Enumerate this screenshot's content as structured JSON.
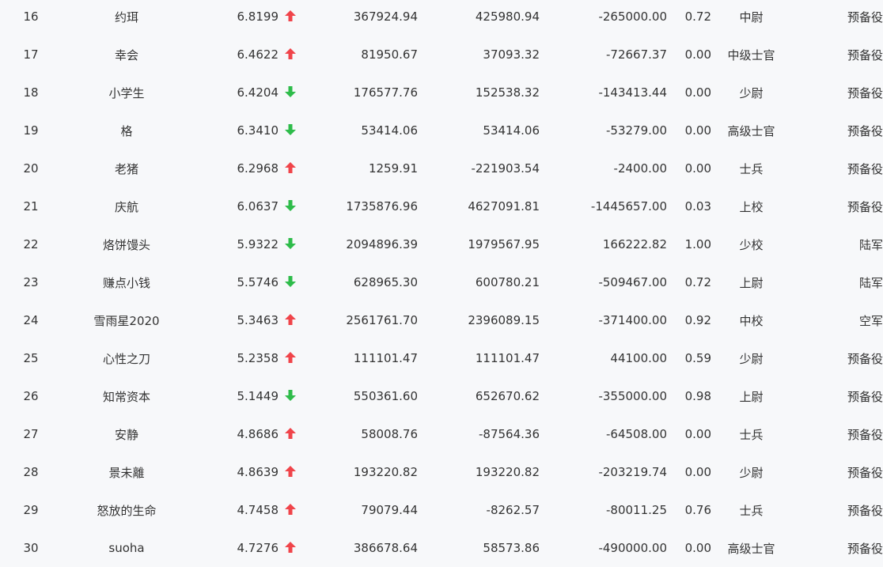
{
  "colors": {
    "up": "#f0444a",
    "down": "#2ebc4a",
    "text": "#333333",
    "background": "#f7f8fa"
  },
  "rows": [
    {
      "rank": "16",
      "name": "约珥",
      "score": "6.8199",
      "trend": "up",
      "trend_icon": "arrow-up-icon",
      "v1": "367924.94",
      "v2": "425980.94",
      "v3": "-265000.00",
      "ratio": "0.72",
      "level": "中尉",
      "branch": "预备役"
    },
    {
      "rank": "17",
      "name": "幸会",
      "score": "6.4622",
      "trend": "up",
      "trend_icon": "arrow-up-icon",
      "v1": "81950.67",
      "v2": "37093.32",
      "v3": "-72667.37",
      "ratio": "0.00",
      "level": "中级士官",
      "branch": "预备役"
    },
    {
      "rank": "18",
      "name": "小学生",
      "score": "6.4204",
      "trend": "down",
      "trend_icon": "arrow-down-icon",
      "v1": "176577.76",
      "v2": "152538.32",
      "v3": "-143413.44",
      "ratio": "0.00",
      "level": "少尉",
      "branch": "预备役"
    },
    {
      "rank": "19",
      "name": "格",
      "score": "6.3410",
      "trend": "down",
      "trend_icon": "arrow-down-icon",
      "v1": "53414.06",
      "v2": "53414.06",
      "v3": "-53279.00",
      "ratio": "0.00",
      "level": "高级士官",
      "branch": "预备役"
    },
    {
      "rank": "20",
      "name": "老猪",
      "score": "6.2968",
      "trend": "up",
      "trend_icon": "arrow-up-icon",
      "v1": "1259.91",
      "v2": "-221903.54",
      "v3": "-2400.00",
      "ratio": "0.00",
      "level": "士兵",
      "branch": "预备役"
    },
    {
      "rank": "21",
      "name": "庆航",
      "score": "6.0637",
      "trend": "down",
      "trend_icon": "arrow-down-icon",
      "v1": "1735876.96",
      "v2": "4627091.81",
      "v3": "-1445657.00",
      "ratio": "0.03",
      "level": "上校",
      "branch": "预备役"
    },
    {
      "rank": "22",
      "name": "烙饼馒头",
      "score": "5.9322",
      "trend": "down",
      "trend_icon": "arrow-down-icon",
      "v1": "2094896.39",
      "v2": "1979567.95",
      "v3": "166222.82",
      "ratio": "1.00",
      "level": "少校",
      "branch": "陆军"
    },
    {
      "rank": "23",
      "name": "赚点小钱",
      "score": "5.5746",
      "trend": "down",
      "trend_icon": "arrow-down-icon",
      "v1": "628965.30",
      "v2": "600780.21",
      "v3": "-509467.00",
      "ratio": "0.72",
      "level": "上尉",
      "branch": "陆军"
    },
    {
      "rank": "24",
      "name": "雪雨星2020",
      "score": "5.3463",
      "trend": "up",
      "trend_icon": "arrow-up-icon",
      "v1": "2561761.70",
      "v2": "2396089.15",
      "v3": "-371400.00",
      "ratio": "0.92",
      "level": "中校",
      "branch": "空军"
    },
    {
      "rank": "25",
      "name": "心性之刀",
      "score": "5.2358",
      "trend": "up",
      "trend_icon": "arrow-up-icon",
      "v1": "111101.47",
      "v2": "111101.47",
      "v3": "44100.00",
      "ratio": "0.59",
      "level": "少尉",
      "branch": "预备役"
    },
    {
      "rank": "26",
      "name": "知常资本",
      "score": "5.1449",
      "trend": "down",
      "trend_icon": "arrow-down-icon",
      "v1": "550361.60",
      "v2": "652670.62",
      "v3": "-355000.00",
      "ratio": "0.98",
      "level": "上尉",
      "branch": "预备役"
    },
    {
      "rank": "27",
      "name": "安静",
      "score": "4.8686",
      "trend": "up",
      "trend_icon": "arrow-up-icon",
      "v1": "58008.76",
      "v2": "-87564.36",
      "v3": "-64508.00",
      "ratio": "0.00",
      "level": "士兵",
      "branch": "预备役"
    },
    {
      "rank": "28",
      "name": "景未離",
      "score": "4.8639",
      "trend": "up",
      "trend_icon": "arrow-up-icon",
      "v1": "193220.82",
      "v2": "193220.82",
      "v3": "-203219.74",
      "ratio": "0.00",
      "level": "少尉",
      "branch": "预备役"
    },
    {
      "rank": "29",
      "name": "怒放的生命",
      "score": "4.7458",
      "trend": "up",
      "trend_icon": "arrow-up-icon",
      "v1": "79079.44",
      "v2": "-8262.57",
      "v3": "-80011.25",
      "ratio": "0.76",
      "level": "士兵",
      "branch": "预备役"
    },
    {
      "rank": "30",
      "name": "suoha",
      "score": "4.7276",
      "trend": "up",
      "trend_icon": "arrow-up-icon",
      "v1": "386678.64",
      "v2": "58573.86",
      "v3": "-490000.00",
      "ratio": "0.00",
      "level": "高级士官",
      "branch": "预备役"
    }
  ]
}
